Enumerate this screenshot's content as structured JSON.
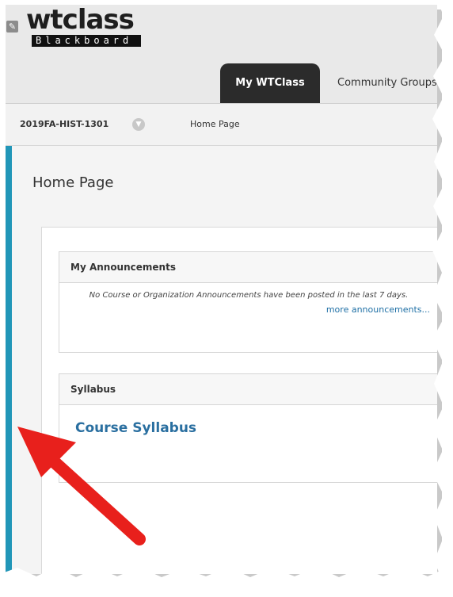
{
  "logo": {
    "wordmark": "wtclass",
    "sub": "Blackboard"
  },
  "tabs": {
    "my_wtclass": "My WTClass",
    "community": "Community Groups"
  },
  "breadcrumb": {
    "course_id": "2019FA-HIST-1301",
    "page": "Home Page"
  },
  "page": {
    "title": "Home Page"
  },
  "announcements": {
    "title": "My Announcements",
    "message": "No Course or Organization Announcements have been posted in the last 7 days.",
    "more_link": "more announcements..."
  },
  "syllabus": {
    "title": "Syllabus",
    "link": "Course Syllabus"
  },
  "colors": {
    "accent_bar": "#2196b8",
    "arrow": "#e8201c",
    "tab_active": "#2b2b2b",
    "link": "#2a6fa0"
  },
  "icons": {
    "edit_badge": "pencil-icon",
    "crumb_menu": "chevron-down-icon",
    "annotation": "red-arrow"
  }
}
